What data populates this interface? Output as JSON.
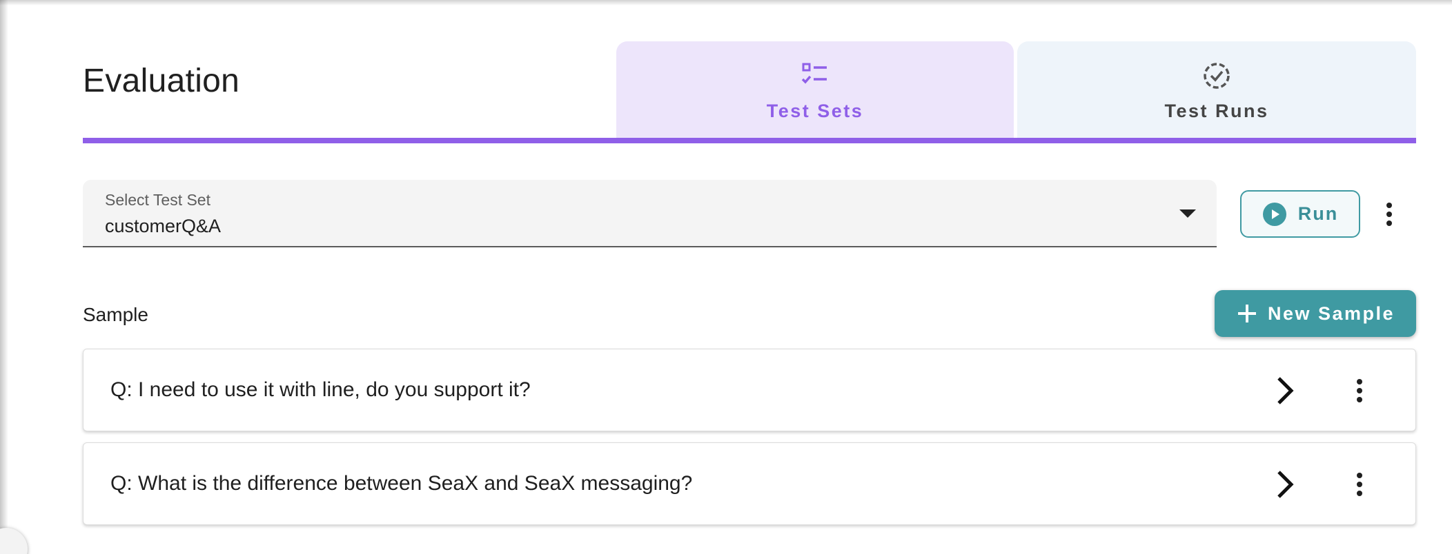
{
  "page": {
    "title": "Evaluation"
  },
  "tabs": [
    {
      "label": "Test Sets",
      "icon": "checklist-icon",
      "selected": true
    },
    {
      "label": "Test Runs",
      "icon": "dashed-circle-check-icon",
      "selected": false
    }
  ],
  "test_set_select": {
    "label": "Select Test Set",
    "value": "customerQ&A"
  },
  "toolbar": {
    "run_label": "Run"
  },
  "sample_section": {
    "label": "Sample",
    "new_sample_label": "New Sample"
  },
  "samples": [
    {
      "question": "Q: I need to use it with line, do you support it?"
    },
    {
      "question": "Q: What is the difference between SeaX and SeaX messaging?"
    }
  ],
  "colors": {
    "accent_purple": "#8f5fe8",
    "tab_selected_bg": "#ede5fb",
    "tab_unselected_bg": "#eef4fa",
    "teal": "#3f9aa2"
  }
}
